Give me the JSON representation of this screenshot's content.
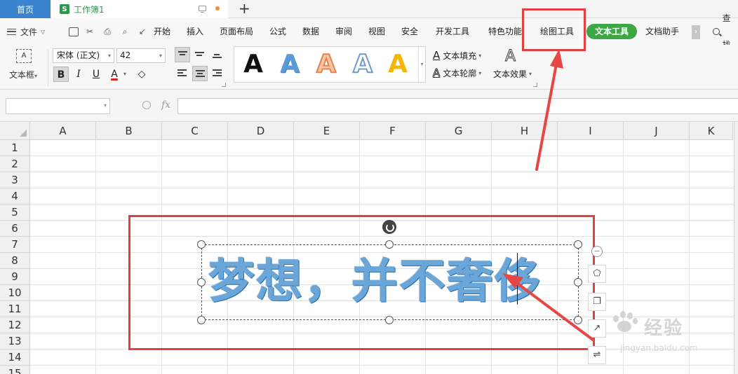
{
  "tabs": {
    "home": "首页",
    "doc_logo": "S",
    "doc_title": "工作簿1",
    "new_tab": "+"
  },
  "menu": {
    "file": "文件",
    "items": [
      "开始",
      "插入",
      "页面布局",
      "公式",
      "数据",
      "审阅",
      "视图",
      "安全",
      "开发工具",
      "特色功能",
      "绘图工具"
    ],
    "active_pill": "文本工具",
    "assistant": "文档助手",
    "more": "›",
    "search": "查找"
  },
  "ribbon": {
    "textbox_icon_text": "A",
    "textbox_label": "文本框",
    "font_name": "宋体 (正文)",
    "font_size": "42",
    "bold": "B",
    "italic": "I",
    "underline": "U",
    "font_color": "A",
    "eraser": "◇",
    "style_letters": [
      "A",
      "A",
      "A",
      "A",
      "A"
    ],
    "text_fill": "文本填充",
    "text_outline": "文本轮廓",
    "text_effect": "文本效果",
    "glyph_a": "A"
  },
  "formula": {
    "fx": "fx"
  },
  "sheet": {
    "columns": [
      "A",
      "B",
      "C",
      "D",
      "E",
      "F",
      "G",
      "H",
      "I",
      "J",
      "K"
    ],
    "rows": [
      "1",
      "2",
      "3",
      "4",
      "5",
      "6",
      "7",
      "8",
      "9",
      "10",
      "11",
      "12",
      "13",
      "14",
      "15"
    ]
  },
  "art_text": "梦想，并不奢侈",
  "watermark": {
    "brand": "Bai du 经验",
    "cn": "经验",
    "url": "jingyan.baidu.com"
  },
  "colors": {
    "accent_blue": "#3b83cf",
    "pill_green": "#3ea745",
    "annotation_red": "#e04040",
    "art_text_fill": "#6aa7d8"
  },
  "icons": [
    "hamburger-icon",
    "save-icon",
    "format-painter-icon",
    "print-icon",
    "print-preview-icon",
    "undo-icon",
    "search-icon",
    "rotate-icon",
    "fx-icon",
    "zoom-icon"
  ]
}
